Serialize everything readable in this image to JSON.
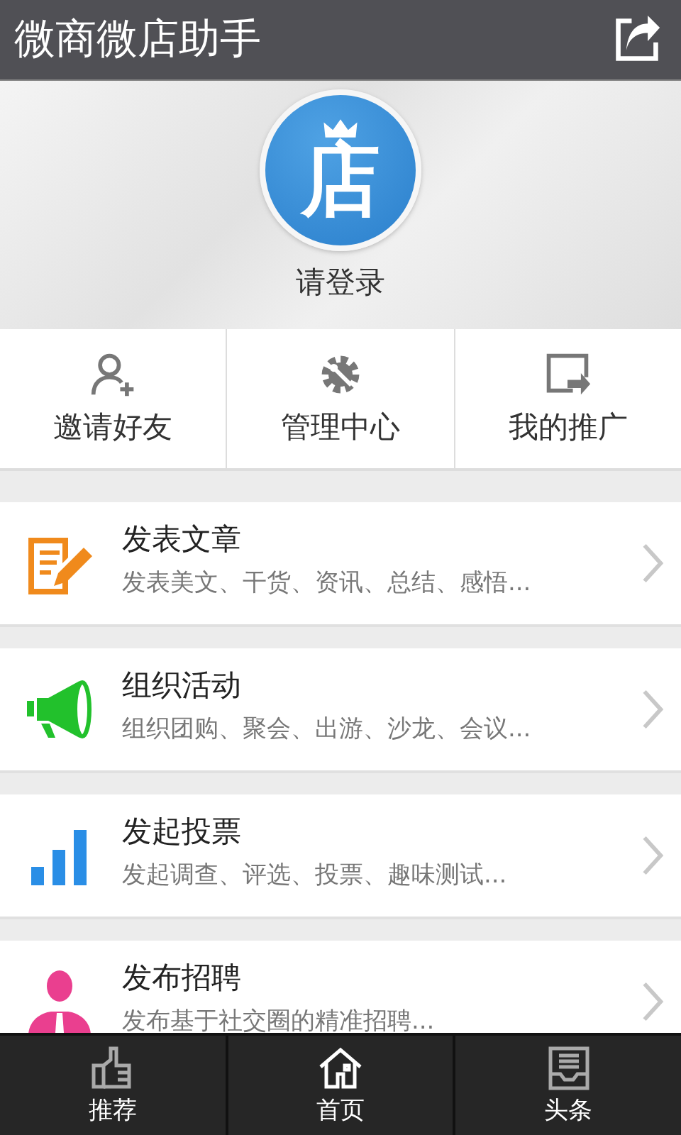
{
  "header": {
    "title": "微商微店助手"
  },
  "profile": {
    "logo_text": "店",
    "login_label": "请登录"
  },
  "quick_actions": [
    {
      "kind": "invite",
      "label": "邀请好友"
    },
    {
      "kind": "manage",
      "label": "管理中心"
    },
    {
      "kind": "promote",
      "label": "我的推广"
    }
  ],
  "features": [
    {
      "kind": "article",
      "color": "#f08a1c",
      "title": "发表文章",
      "subtitle": "发表美文、干货、资讯、总结、感悟..."
    },
    {
      "kind": "activity",
      "color": "#22c12c",
      "title": "组织活动",
      "subtitle": "组织团购、聚会、出游、沙龙、会议..."
    },
    {
      "kind": "vote",
      "color": "#2a8ee6",
      "title": "发起投票",
      "subtitle": "发起调查、评选、投票、趣味测试..."
    },
    {
      "kind": "recruit",
      "color": "#ea3f8f",
      "title": "发布招聘",
      "subtitle": "发布基于社交圈的精准招聘..."
    }
  ],
  "bottom_tabs": [
    {
      "kind": "recommend",
      "label": "推荐"
    },
    {
      "kind": "home",
      "label": "首页"
    },
    {
      "kind": "headlines",
      "label": "头条"
    }
  ]
}
